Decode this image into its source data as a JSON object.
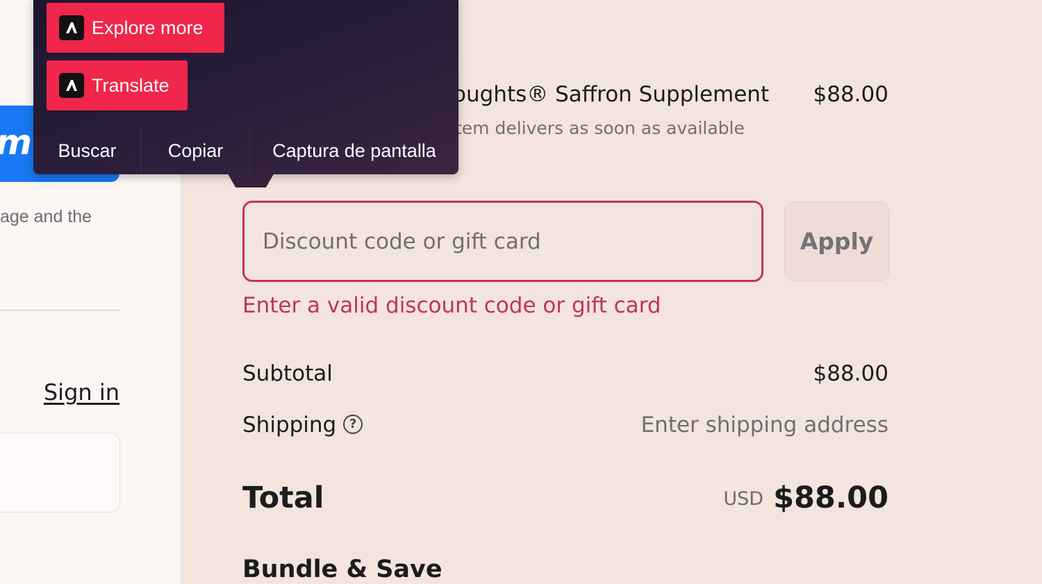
{
  "left": {
    "brand_fragment": "m",
    "text_fragment": "age and the",
    "sign_in": "Sign in"
  },
  "product": {
    "name": "oughts® Saffron Supplement",
    "price": "$88.00",
    "note": "tem delivers as soon as available"
  },
  "discount": {
    "placeholder": "Discount code or gift card",
    "value": "",
    "apply_label": "Apply",
    "error": "Enter a valid discount code or gift card"
  },
  "summary": {
    "subtotal_label": "Subtotal",
    "subtotal_value": "$88.00",
    "shipping_label": "Shipping",
    "shipping_help_icon": "?",
    "shipping_value": "Enter shipping address",
    "total_label": "Total",
    "currency": "USD",
    "total_value": "$88.00"
  },
  "bundle": {
    "title": "Bundle & Save"
  },
  "popup": {
    "explore_label": "Explore more",
    "translate_label": "Translate",
    "actions": [
      "Buscar",
      "Copiar",
      "Captura de pantalla"
    ]
  },
  "colors": {
    "page_bg": "#f3e4de",
    "error": "#c0345c",
    "brand_blue": "#1878f3",
    "popup_accent": "#f0264a"
  }
}
